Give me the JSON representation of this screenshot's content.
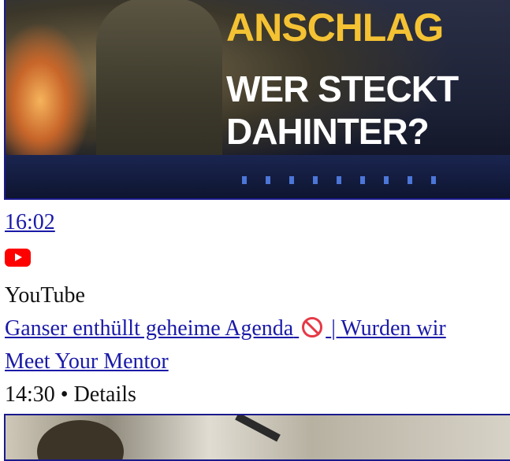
{
  "thumbnail_top": {
    "headline_line1": "ANSCHLAG",
    "headline_line2": "WER STECKT",
    "headline_line3": "DAHINTER?",
    "accent_color": "#f4c233"
  },
  "video": {
    "duration": "16:02",
    "source_icon": "youtube-icon",
    "source": "YouTube",
    "title_part1": "Ganser enthüllt geheime Agenda",
    "title_icon": "prohibited-icon",
    "title_part2": "| Wurden wir",
    "channel": "Meet Your Mentor",
    "meta": "14:30 • Details"
  },
  "colors": {
    "link": "#1a1aa8",
    "youtube_red": "#ff0000",
    "border": "#1a1a8c"
  }
}
